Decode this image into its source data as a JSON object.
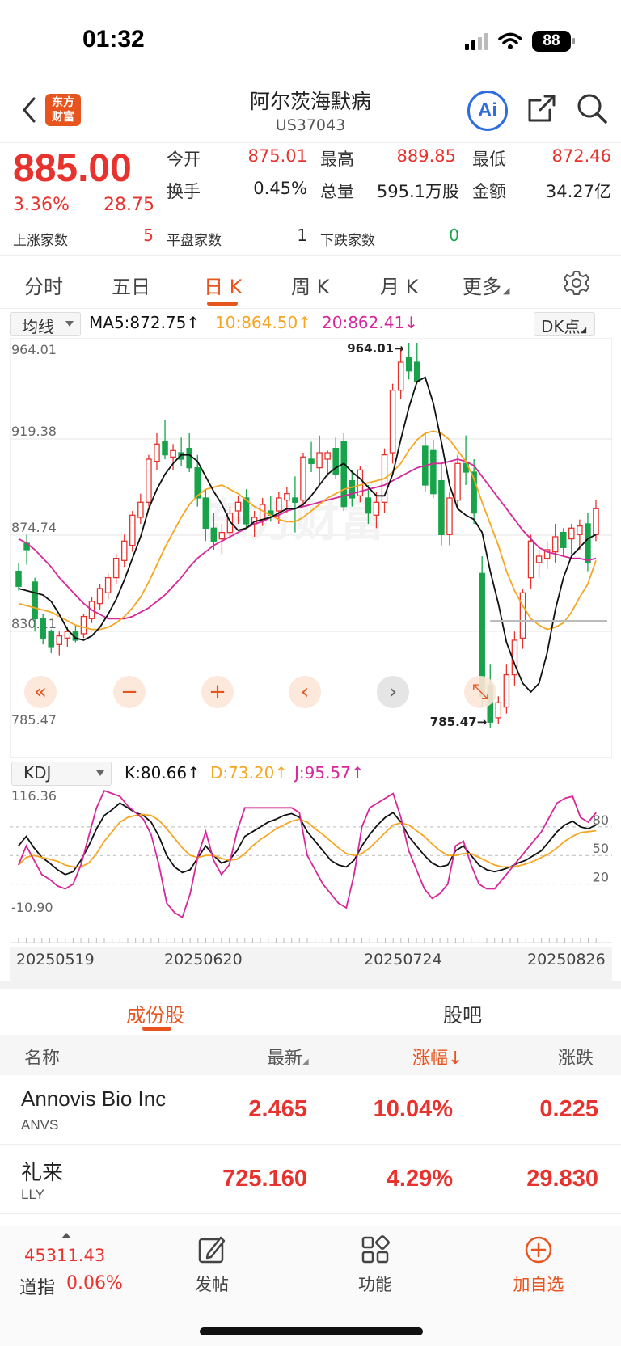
{
  "status": {
    "time": "01:32",
    "battery": "88"
  },
  "header": {
    "title": "阿尔茨海默病",
    "code": "US37043",
    "logo_line1": "东方",
    "logo_line2": "财富",
    "ai_label": "Ai"
  },
  "quote": {
    "price": "885.00",
    "pct": "3.36%",
    "change": "28.75",
    "open_label": "今开",
    "open": "875.01",
    "high_label": "最高",
    "high": "889.85",
    "low_label": "最低",
    "low": "872.46",
    "turnover_label": "换手",
    "turnover": "0.45%",
    "volume_label": "总量",
    "volume": "595.1万股",
    "amount_label": "金额",
    "amount": "34.27亿",
    "up_label": "上涨家数",
    "up": "5",
    "flat_label": "平盘家数",
    "flat": "1",
    "down_label": "下跌家数",
    "down": "0"
  },
  "tabs": [
    "分时",
    "五日",
    "日 K",
    "周 K",
    "月 K",
    "更多"
  ],
  "ma": {
    "selector": "均线",
    "ma5": "MA5:872.75↑",
    "ma10": "10:864.50↑",
    "ma20": "20:862.41↓",
    "dk": "DK点"
  },
  "kdj": {
    "selector": "KDJ",
    "k": "K:80.66↑",
    "d": "D:73.20↑",
    "j": "J:95.57↑"
  },
  "colors": {
    "up": "#e8322d",
    "down": "#18a34a",
    "ma5": "#111111",
    "ma10": "#f5a623",
    "ma20": "#d6279b",
    "accent": "#e8541e"
  },
  "chart_data": [
    {
      "type": "candlestick",
      "y_labels": [
        "964.01",
        "919.38",
        "874.74",
        "830.11",
        "785.47"
      ],
      "ylim": [
        785.47,
        964.01
      ],
      "max_label": "964.01→",
      "min_label": "785.47→",
      "watermark": "东方财富",
      "ohlc": [
        [
          858,
          862,
          849,
          851
        ],
        [
          871,
          875,
          861,
          868
        ],
        [
          853,
          855,
          830,
          836
        ],
        [
          836,
          838,
          824,
          827
        ],
        [
          830,
          831,
          820,
          823
        ],
        [
          824,
          830,
          819,
          828
        ],
        [
          827,
          832,
          823,
          830
        ],
        [
          830,
          833,
          825,
          826
        ],
        [
          829,
          838,
          827,
          837
        ],
        [
          836,
          846,
          834,
          844
        ],
        [
          843,
          852,
          840,
          850
        ],
        [
          848,
          857,
          845,
          855
        ],
        [
          855,
          866,
          852,
          864
        ],
        [
          863,
          875,
          860,
          872
        ],
        [
          870,
          886,
          867,
          884
        ],
        [
          883,
          894,
          880,
          890
        ],
        [
          890,
          912,
          888,
          910
        ],
        [
          909,
          922,
          905,
          917
        ],
        [
          918,
          928,
          910,
          912
        ],
        [
          911,
          917,
          905,
          914
        ],
        [
          913,
          920,
          907,
          910
        ],
        [
          915,
          922,
          904,
          906
        ],
        [
          906,
          912,
          888,
          892
        ],
        [
          892,
          896,
          872,
          878
        ],
        [
          878,
          885,
          868,
          872
        ],
        [
          873,
          880,
          866,
          876
        ],
        [
          876,
          888,
          873,
          885
        ],
        [
          886,
          893,
          880,
          890
        ],
        [
          892,
          896,
          878,
          880
        ],
        [
          880,
          886,
          874,
          883
        ],
        [
          882,
          892,
          879,
          889
        ],
        [
          886,
          893,
          881,
          884
        ],
        [
          886,
          895,
          880,
          892
        ],
        [
          891,
          897,
          885,
          894
        ],
        [
          892,
          902,
          876,
          890
        ],
        [
          891,
          913,
          888,
          911
        ],
        [
          910,
          918,
          904,
          908
        ],
        [
          906,
          921,
          898,
          913
        ],
        [
          910,
          914,
          902,
          913
        ],
        [
          915,
          920,
          901,
          903
        ],
        [
          918,
          922,
          886,
          888
        ],
        [
          900,
          905,
          888,
          892
        ],
        [
          893,
          907,
          890,
          905
        ],
        [
          892,
          898,
          880,
          885
        ],
        [
          884,
          895,
          878,
          890
        ],
        [
          890,
          915,
          885,
          912
        ],
        [
          913,
          945,
          908,
          942
        ],
        [
          942,
          961,
          938,
          955
        ],
        [
          957,
          964,
          947,
          951
        ],
        [
          955,
          964,
          945,
          946
        ],
        [
          916,
          922,
          895,
          898
        ],
        [
          914,
          919,
          892,
          894
        ],
        [
          900,
          908,
          870,
          875
        ],
        [
          875,
          895,
          870,
          892
        ],
        [
          891,
          912,
          888,
          908
        ],
        [
          908,
          921,
          898,
          904
        ],
        [
          904,
          910,
          880,
          885
        ],
        [
          857,
          865,
          795,
          800
        ],
        [
          805,
          815,
          785.5,
          788
        ],
        [
          790,
          800,
          787,
          797
        ],
        [
          795,
          815,
          792,
          810
        ],
        [
          810,
          830,
          805,
          826
        ],
        [
          827,
          850,
          822,
          848
        ],
        [
          855,
          875,
          850,
          872
        ],
        [
          862,
          868,
          855,
          865
        ],
        [
          864,
          872,
          859,
          868
        ],
        [
          867,
          880,
          862,
          874
        ],
        [
          876,
          878,
          865,
          869
        ],
        [
          873,
          880,
          866,
          878
        ],
        [
          875,
          882,
          868,
          879
        ],
        [
          880,
          885,
          858,
          862
        ],
        [
          875,
          891,
          872,
          887
        ]
      ],
      "ma5": [
        850,
        849,
        848,
        847,
        844,
        838,
        831,
        827,
        826,
        828,
        832,
        838,
        845,
        854,
        864,
        874,
        887,
        896,
        903,
        908,
        912,
        912,
        909,
        902,
        895,
        889,
        881,
        877,
        878,
        881,
        882,
        883,
        885,
        887,
        887,
        889,
        893,
        898,
        903,
        906,
        908,
        904,
        901,
        897,
        893,
        893,
        903,
        919,
        934,
        946,
        948,
        936,
        918,
        898,
        887,
        884,
        882,
        876,
        858,
        843,
        825,
        815,
        806,
        802,
        806,
        820,
        840,
        855,
        865,
        869,
        873,
        875
      ],
      "ma10": [
        843,
        842,
        841,
        840,
        839,
        837,
        835,
        833,
        832,
        831,
        831,
        832,
        834,
        837,
        841,
        846,
        853,
        861,
        869,
        876,
        883,
        889,
        893,
        896,
        897,
        898,
        896,
        894,
        891,
        888,
        886,
        884,
        882,
        881,
        881,
        883,
        886,
        889,
        892,
        894,
        896,
        897,
        898,
        899,
        900,
        901,
        904,
        908,
        914,
        919,
        922,
        923,
        922,
        919,
        914,
        909,
        901,
        890,
        880,
        870,
        858,
        849,
        842,
        836,
        833,
        831,
        832,
        834,
        839,
        846,
        852,
        863
      ],
      "ma20": [
        873,
        871,
        868,
        864,
        860,
        855,
        851,
        847,
        843,
        840,
        838,
        836,
        836,
        836,
        837,
        839,
        841,
        844,
        847,
        851,
        855,
        860,
        864,
        867,
        870,
        872,
        874,
        876,
        878,
        880,
        881,
        883,
        884,
        886,
        887,
        888,
        889,
        890,
        891,
        892,
        893,
        894,
        895,
        896,
        897,
        898,
        900,
        902,
        904,
        906,
        907,
        908,
        908,
        909,
        910,
        909,
        907,
        902,
        897,
        892,
        887,
        882,
        877,
        873,
        869,
        867,
        866,
        865,
        864,
        864,
        863,
        864
      ]
    },
    {
      "type": "line",
      "title": "KDJ",
      "y_labels": [
        "116.36",
        "80",
        "50",
        "20",
        "-10.90"
      ],
      "ylim": [
        -10.9,
        116.36
      ],
      "x_labels": [
        "20250519",
        "20250620",
        "20250724",
        "20250826"
      ],
      "series": [
        {
          "name": "K",
          "values": [
            60,
            70,
            58,
            48,
            42,
            35,
            30,
            33,
            45,
            60,
            78,
            92,
            98,
            105,
            100,
            95,
            92,
            85,
            70,
            50,
            38,
            32,
            35,
            48,
            60,
            50,
            42,
            45,
            55,
            70,
            75,
            80,
            85,
            88,
            92,
            94,
            90,
            75,
            65,
            55,
            45,
            40,
            38,
            45,
            60,
            72,
            82,
            90,
            95,
            85,
            70,
            60,
            50,
            42,
            38,
            40,
            55,
            60,
            50,
            40,
            35,
            33,
            35,
            38,
            42,
            45,
            50,
            55,
            65,
            75,
            82,
            86,
            80,
            78,
            82
          ]
        },
        {
          "name": "D",
          "values": [
            40,
            48,
            50,
            48,
            46,
            44,
            40,
            38,
            38,
            42,
            52,
            65,
            75,
            85,
            90,
            92,
            93,
            92,
            87,
            78,
            68,
            58,
            50,
            48,
            50,
            50,
            47,
            45,
            46,
            52,
            60,
            67,
            72,
            78,
            82,
            86,
            88,
            85,
            78,
            72,
            65,
            58,
            52,
            50,
            52,
            58,
            66,
            74,
            82,
            84,
            82,
            76,
            70,
            62,
            55,
            50,
            50,
            52,
            52,
            48,
            44,
            40,
            38,
            38,
            39,
            41,
            44,
            48,
            52,
            58,
            65,
            70,
            74,
            75,
            76
          ]
        },
        {
          "name": "J",
          "values": [
            40,
            60,
            45,
            30,
            25,
            18,
            15,
            20,
            40,
            70,
            100,
            118,
            115,
            112,
            102,
            95,
            88,
            72,
            40,
            0,
            -10,
            -15,
            10,
            50,
            75,
            45,
            30,
            40,
            75,
            100,
            100,
            100,
            100,
            100,
            100,
            100,
            95,
            50,
            35,
            20,
            10,
            0,
            -5,
            30,
            80,
            100,
            105,
            110,
            115,
            90,
            55,
            35,
            15,
            5,
            10,
            20,
            60,
            65,
            40,
            20,
            15,
            15,
            25,
            35,
            45,
            55,
            65,
            75,
            90,
            105,
            110,
            112,
            90,
            85,
            95
          ]
        }
      ]
    }
  ],
  "sub_tabs": {
    "left": "成份股",
    "right": "股吧"
  },
  "table": {
    "headers": {
      "name": "名称",
      "latest": "最新",
      "pct": "涨幅↓",
      "change": "涨跌"
    },
    "rows": [
      {
        "name": "Annovis Bio Inc",
        "code": "ANVS",
        "latest": "2.465",
        "pct": "10.04%",
        "change": "0.225"
      },
      {
        "name": "礼来",
        "code": "LLY",
        "latest": "725.160",
        "pct": "4.29%",
        "change": "29.830"
      }
    ]
  },
  "bottom": {
    "index_value": "45311.43",
    "index_name": "道指",
    "index_pct": "0.06%",
    "post": "发帖",
    "func": "功能",
    "add": "加自选"
  }
}
